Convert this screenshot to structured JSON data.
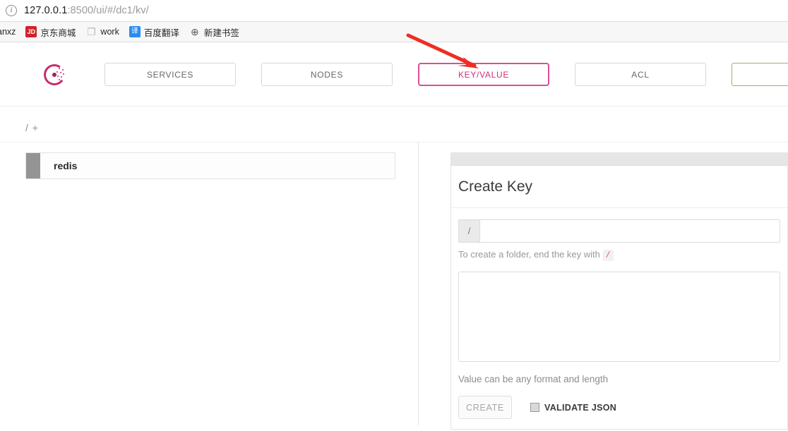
{
  "browser": {
    "info_icon": "info-circle-icon",
    "url_host": "127.0.0.1",
    "url_path": ":8500/ui/#/dc1/kv/",
    "bookmarks": [
      {
        "icon": "text-icon",
        "label": "anxz"
      },
      {
        "icon": "jd-icon",
        "label": "京东商城",
        "glyph": "JD"
      },
      {
        "icon": "folder-icon",
        "label": "work",
        "glyph": "❐"
      },
      {
        "icon": "translate-icon",
        "label": "百度翻译",
        "glyph": "译"
      },
      {
        "icon": "globe-icon",
        "label": "新建书签",
        "glyph": "⊕"
      }
    ]
  },
  "app": {
    "logo_name": "consul-logo",
    "tabs": [
      {
        "label": "SERVICES",
        "state": "default"
      },
      {
        "label": "NODES",
        "state": "default"
      },
      {
        "label": "KEY/VALUE",
        "state": "active"
      },
      {
        "label": "ACL",
        "state": "default"
      },
      {
        "label": "",
        "state": "green"
      }
    ],
    "breadcrumb": "/ +",
    "kv_list": [
      {
        "label": "redis"
      }
    ],
    "panel": {
      "title": "Create Key",
      "key_addon": "/",
      "key_value": "",
      "key_placeholder": "",
      "key_help_prefix": "To create a folder, end the key with",
      "key_help_code": "/",
      "value_text": "",
      "value_placeholder": "",
      "value_help": "Value can be any format and length",
      "create_label": "CREATE",
      "validate_label": "VALIDATE JSON",
      "validate_checked": false
    }
  },
  "annotation": {
    "arrow_name": "red-arrow-annotation",
    "arrow_color": "#ee2d24"
  },
  "colors": {
    "accent_pink": "#d42a7c",
    "accent_green": "#9cb36a",
    "arrow_red": "#ee2d24"
  }
}
